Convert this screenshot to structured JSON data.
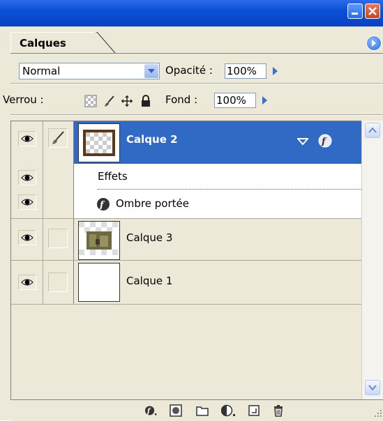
{
  "window": {
    "minimize_label": "",
    "close_label": ""
  },
  "panel": {
    "tab_label": "Calques"
  },
  "blend": {
    "mode": "Normal",
    "opacity_label": "Opacité :",
    "opacity_value": "100%"
  },
  "lock": {
    "label": "Verrou :",
    "fill_label": "Fond :",
    "fill_value": "100%"
  },
  "layers": [
    {
      "name": "Calque 2",
      "selected": true,
      "effects_label": "Effets",
      "effect_name": "Ombre portée"
    },
    {
      "name": "Calque 3",
      "selected": false
    },
    {
      "name": "Calque 1",
      "selected": false
    }
  ],
  "colors": {
    "titlebar": "#0a4fd6",
    "selection": "#316ac5",
    "panel_bg": "#ece9d8"
  },
  "icons": [
    "visibility-eye-icon",
    "brush-link-icon",
    "fx-icon",
    "layer-mask-icon",
    "folder-icon",
    "adjustment-layer-icon",
    "new-layer-icon",
    "trash-icon",
    "lock-transparency-icon",
    "lock-paint-icon",
    "lock-move-icon",
    "lock-all-icon"
  ]
}
